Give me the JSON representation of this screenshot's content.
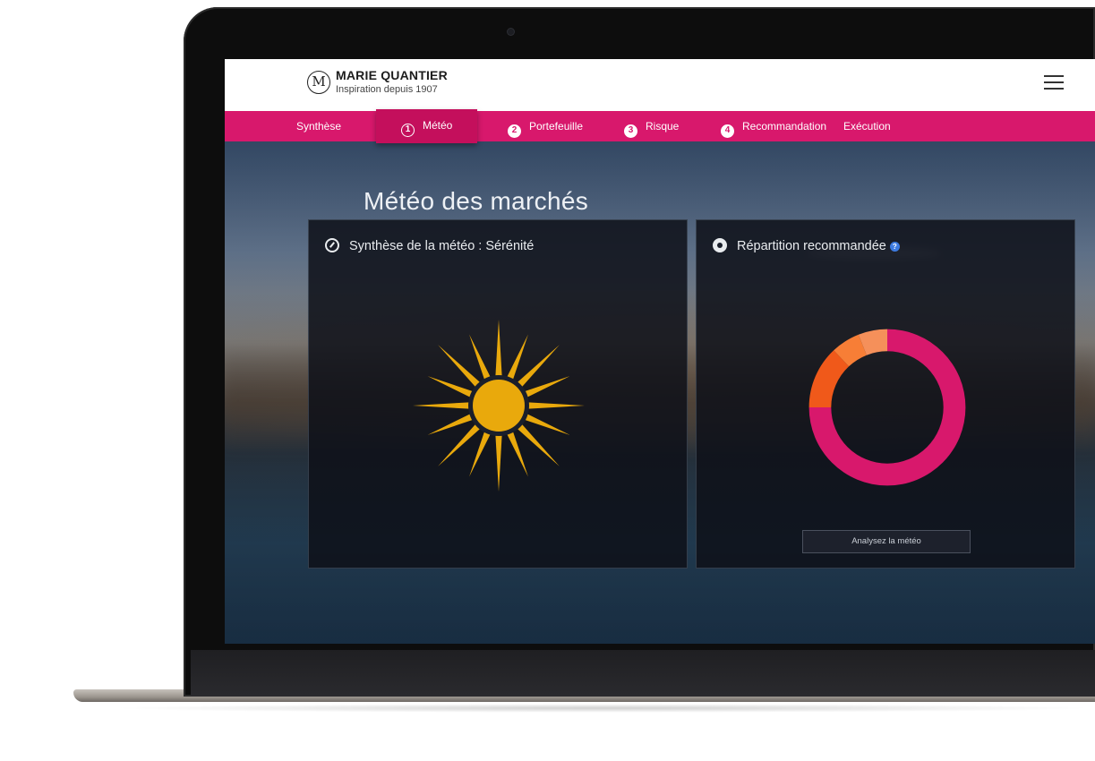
{
  "brand": {
    "name": "MARIE QUANTIER",
    "tagline": "Inspiration depuis 1907",
    "logo_letter": "M"
  },
  "nav": {
    "items": [
      {
        "label": "Synthèse",
        "number": ""
      },
      {
        "label": "Météo",
        "number": "1",
        "active": true
      },
      {
        "label": "Portefeuille",
        "number": "2"
      },
      {
        "label": "Risque",
        "number": "3"
      },
      {
        "label": "Recommandation",
        "number": "4"
      },
      {
        "label": "Exécution",
        "number": ""
      }
    ]
  },
  "page": {
    "title": "Météo des marchés"
  },
  "weather_panel": {
    "title": "Synthèse de la météo : Sérénité",
    "icon": "gauge-icon",
    "weather_icon": "sun-icon"
  },
  "allocation_panel": {
    "title": "Répartition recommandée",
    "help_icon": "?",
    "button_label": "Analysez la météo"
  },
  "colors": {
    "accent": "#d8186c",
    "sun": "#e9a90c",
    "donut_main": "#d8186c",
    "donut_orange": "#f0591a",
    "donut_orange_light": "#f77e36",
    "donut_peach": "#f5905a"
  },
  "chart_data": {
    "type": "pie",
    "values": [
      75,
      13,
      6,
      6
    ],
    "colors": [
      "#d8186c",
      "#f0591a",
      "#f77e36",
      "#f5905a"
    ]
  }
}
